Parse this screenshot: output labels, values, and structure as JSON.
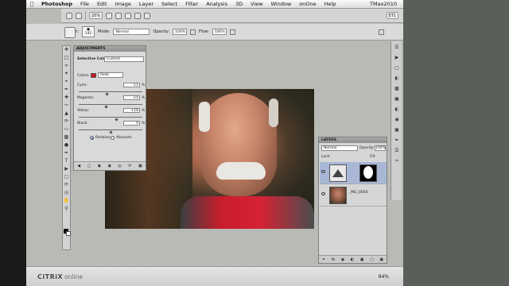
{
  "menubar": {
    "app": "Photoshop",
    "items": [
      "File",
      "Edit",
      "Image",
      "Layer",
      "Select",
      "Filter",
      "Analysis",
      "3D",
      "View",
      "Window",
      "onOne",
      "Help"
    ],
    "right": "TMax2010"
  },
  "appbar": {
    "zoom": "25%",
    "workspace": "ET1"
  },
  "options": {
    "brush_label": "Brush:",
    "brush_size": "141",
    "mode_label": "Mode:",
    "mode_value": "Normal",
    "opacity_label": "Opacity:",
    "opacity_value": "100%",
    "flow_label": "Flow:",
    "flow_value": "100%"
  },
  "adjustments": {
    "title": "ADJUSTMENTS",
    "subtitle": "Selective Color",
    "preset": "Custom",
    "colors_label": "Colors:",
    "colors_value": "Reds",
    "sliders": [
      {
        "label": "Cyan:",
        "value": "-11",
        "level": -11
      },
      {
        "label": "Magenta:",
        "value": "-14",
        "level": -14
      },
      {
        "label": "Yellow:",
        "value": "+18",
        "level": 18
      },
      {
        "label": "Black:",
        "value": "0",
        "level": 0
      }
    ],
    "relative_label": "Relative",
    "absolute_label": "Absolute"
  },
  "layers": {
    "title": "LAYERS",
    "blend": "Normal",
    "opacity_label": "Opacity:",
    "opacity_value": "100%",
    "lock_label": "Lock:",
    "fill_label": "Fill:",
    "layer_names": [
      "",
      "_MG_0056"
    ]
  },
  "footer": {
    "brand": "CiTRiX",
    "brand2": "online",
    "zoom": "94%"
  }
}
